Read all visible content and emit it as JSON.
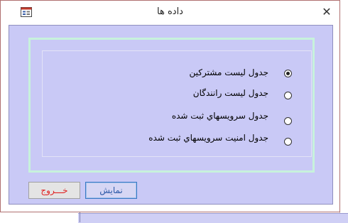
{
  "window": {
    "title": "داده ها",
    "close_glyph": "✕"
  },
  "options": [
    {
      "label": "جدول ليست مشتركين",
      "checked": true
    },
    {
      "label": "جدول ليست رانندگان",
      "checked": false
    },
    {
      "label": "جدول سرويسهاي ثبت شده",
      "checked": false
    },
    {
      "label": "جدول امنيت سرويسهاي ثبت شده",
      "checked": false
    }
  ],
  "buttons": {
    "show_label": "نمايش",
    "exit_label": "خـــروج"
  },
  "colors": {
    "client_bg": "#c9c9f6",
    "frame_border": "#c7f2dc",
    "exit_text": "#e02020",
    "show_text": "#2e5aa8"
  }
}
